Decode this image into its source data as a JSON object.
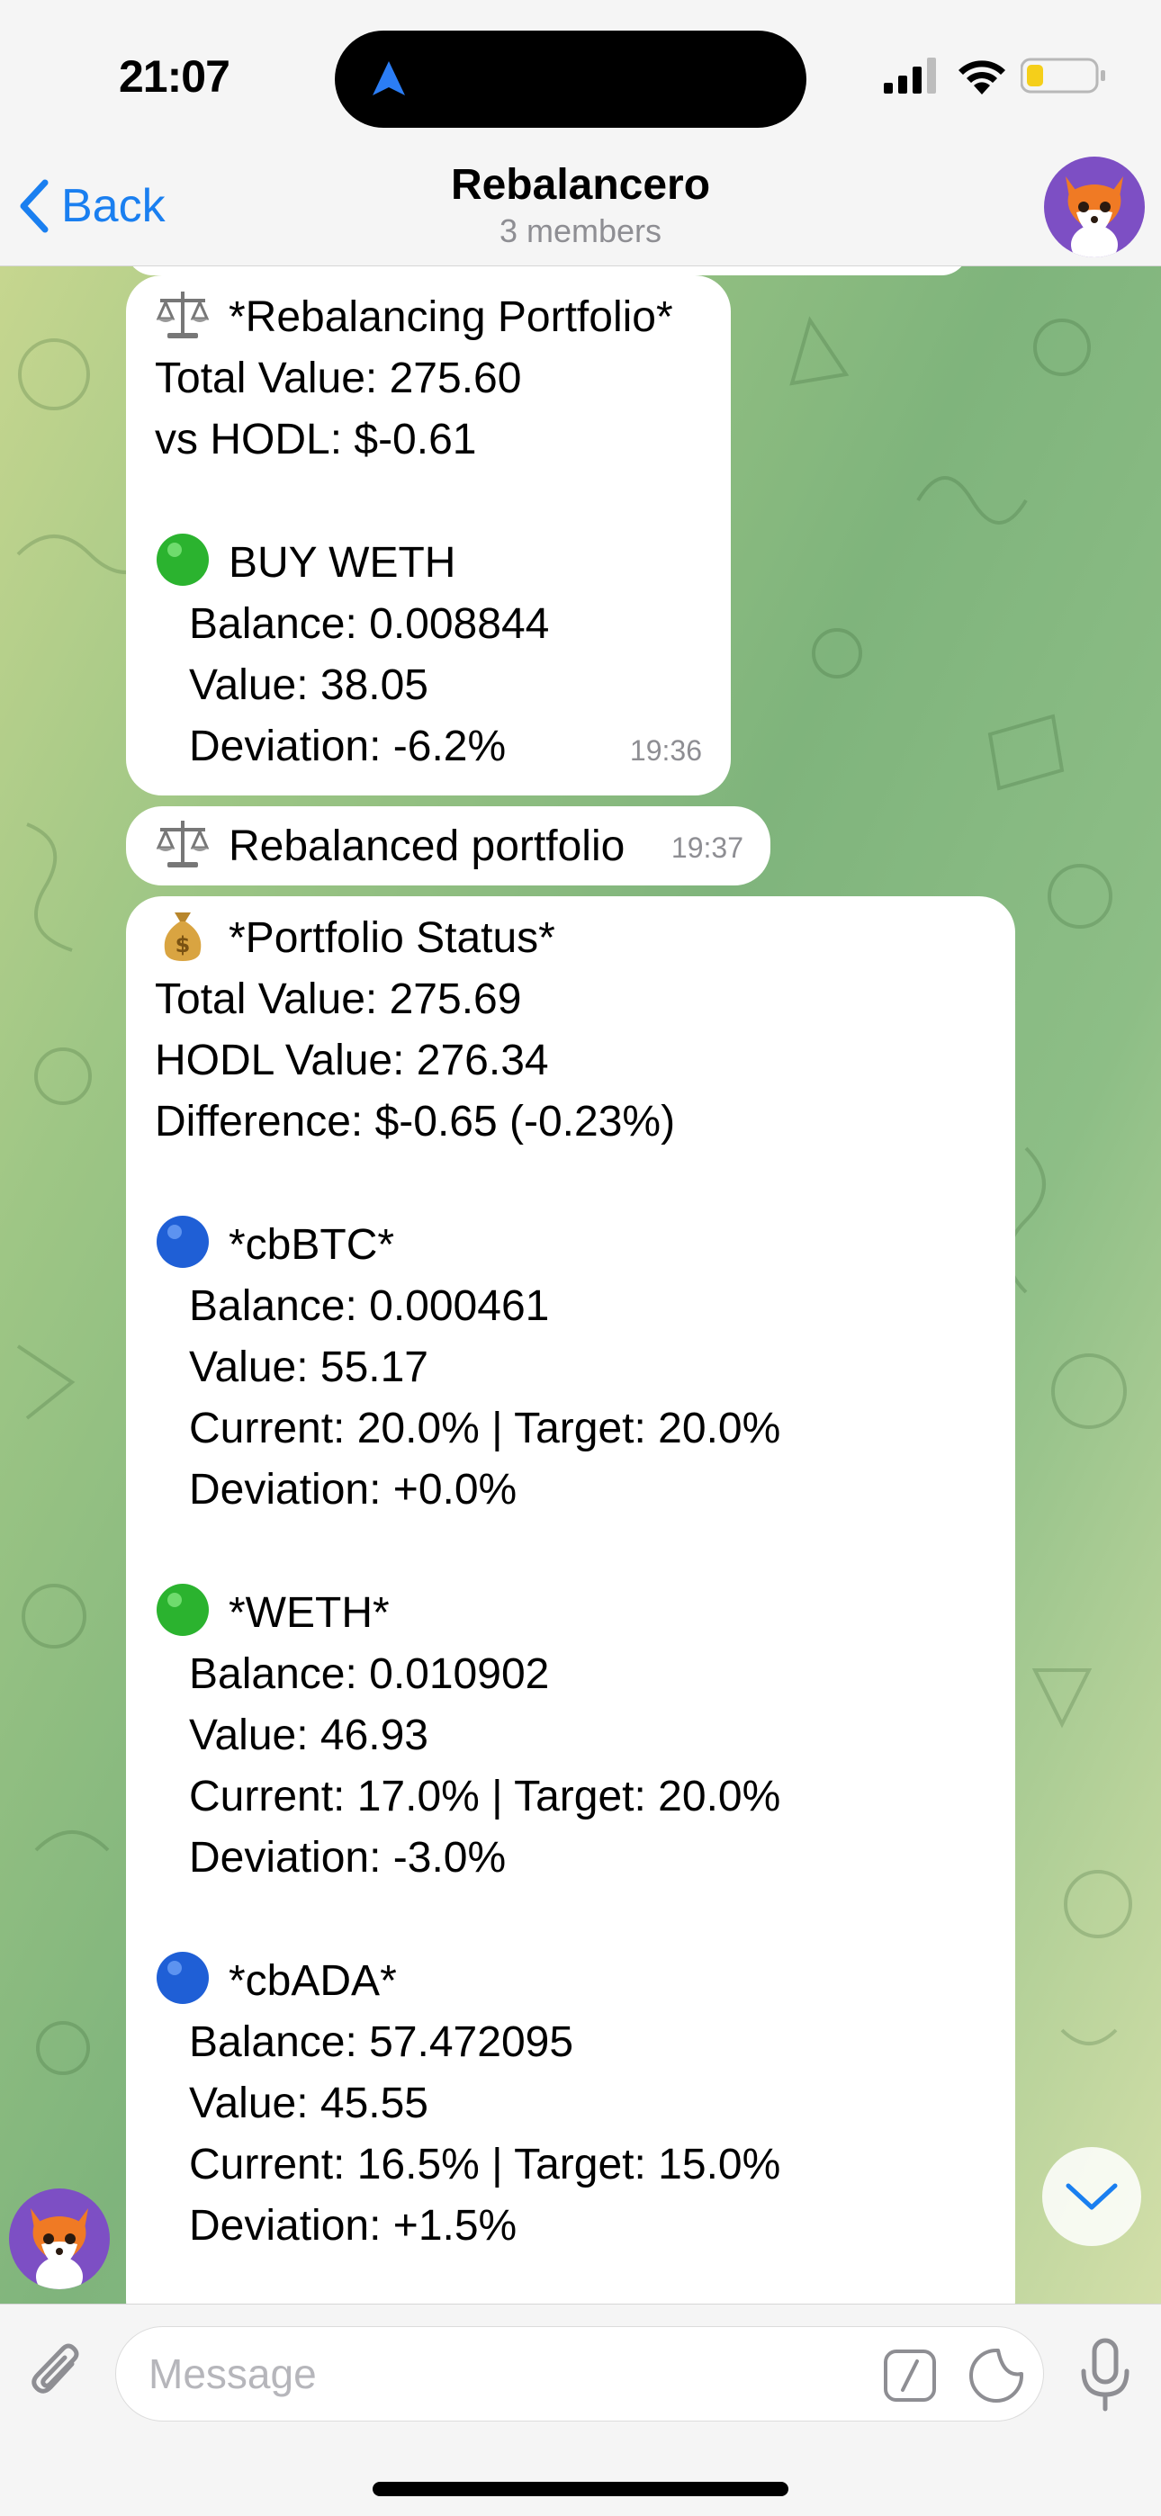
{
  "status_bar": {
    "time": "21:07",
    "icons": [
      "location-arrow-icon",
      "cellular-signal-icon",
      "wifi-icon",
      "battery-low-icon"
    ]
  },
  "nav": {
    "back_label": "Back",
    "title": "Rebalancero",
    "subtitle": "3 members"
  },
  "messages": [
    {
      "time": "19:36",
      "lines": [
        {
          "emoji": "balance-scale-icon",
          "text": "*Rebalancing Portfolio*"
        },
        {
          "text": "Total Value: 275.60"
        },
        {
          "text": "vs HODL: $-0.61"
        },
        {
          "text": ""
        },
        {
          "emoji": "green-circle-icon",
          "text": "BUY WETH"
        },
        {
          "indent": true,
          "text": "Balance: 0.008844"
        },
        {
          "indent": true,
          "text": "Value: 38.05"
        },
        {
          "indent": true,
          "text": "Deviation: -6.2%"
        }
      ]
    },
    {
      "time": "19:37",
      "lines": [
        {
          "emoji": "balance-scale-icon",
          "text": "Rebalanced portfolio"
        }
      ]
    },
    {
      "lines": [
        {
          "emoji": "money-bag-icon",
          "text": "*Portfolio Status*"
        },
        {
          "text": "Total Value: 275.69"
        },
        {
          "text": "HODL Value: 276.34"
        },
        {
          "text": "Difference: $-0.65 (-0.23%)"
        },
        {
          "text": ""
        },
        {
          "emoji": "blue-circle-icon",
          "text": "*cbBTC*"
        },
        {
          "indent": true,
          "text": "Balance: 0.000461"
        },
        {
          "indent": true,
          "text": "Value: 55.17"
        },
        {
          "indent": true,
          "text": "Current: 20.0% | Target: 20.0%"
        },
        {
          "indent": true,
          "text": "Deviation: +0.0%"
        },
        {
          "text": ""
        },
        {
          "emoji": "green-circle-icon",
          "text": "*WETH*"
        },
        {
          "indent": true,
          "text": "Balance: 0.010902"
        },
        {
          "indent": true,
          "text": "Value: 46.93"
        },
        {
          "indent": true,
          "text": "Current: 17.0% | Target: 20.0%"
        },
        {
          "indent": true,
          "text": "Deviation: -3.0%"
        },
        {
          "text": ""
        },
        {
          "emoji": "blue-circle-icon",
          "text": "*cbADA*"
        },
        {
          "indent": true,
          "text": "Balance: 57.472095"
        },
        {
          "indent": true,
          "text": "Value: 45.55"
        },
        {
          "indent": true,
          "text": "Current: 16.5% | Target: 15.0%"
        },
        {
          "indent": true,
          "text": "Deviation: +1.5%"
        }
      ]
    }
  ],
  "input": {
    "placeholder": "Message"
  },
  "colors": {
    "accent": "#1a7ff0",
    "avatar_bg": "#7d4fc4",
    "bubble": "#ffffff",
    "time_text": "#8e8e93"
  }
}
